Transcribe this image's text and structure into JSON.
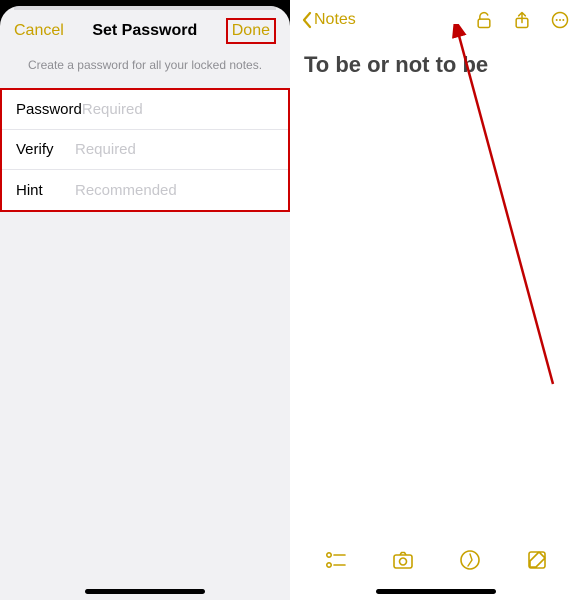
{
  "left": {
    "cancel": "Cancel",
    "title": "Set Password",
    "done": "Done",
    "subtitle": "Create a password for all your locked notes.",
    "fields": {
      "password": {
        "label": "Password",
        "placeholder": "Required"
      },
      "verify": {
        "label": "Verify",
        "placeholder": "Required"
      },
      "hint": {
        "label": "Hint",
        "placeholder": "Recommended"
      }
    }
  },
  "right": {
    "back": "Notes",
    "note_title": "To be or not to be",
    "icons": {
      "lock": "lock-open-icon",
      "share": "share-icon",
      "more": "more-icon"
    },
    "toolbar": {
      "checklist": "checklist-icon",
      "camera": "camera-icon",
      "draw": "draw-icon",
      "compose": "compose-icon"
    }
  },
  "colors": {
    "accent": "#c7a100",
    "annotation": "#c00000"
  }
}
